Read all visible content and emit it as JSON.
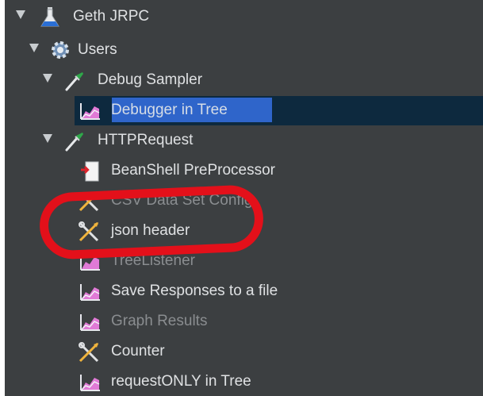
{
  "tree": {
    "items": [
      {
        "label": "Geth JRPC",
        "icon": "flask-icon",
        "expanded": true
      },
      {
        "label": "Users",
        "icon": "gear-icon",
        "expanded": true
      },
      {
        "label": "Debug Sampler",
        "icon": "pipette-icon",
        "expanded": true
      },
      {
        "label": "Debugger in Tree",
        "icon": "listener-chart-icon",
        "selected": true
      },
      {
        "label": "HTTPRequest",
        "icon": "pipette-icon",
        "expanded": true
      },
      {
        "label": "BeanShell PreProcessor",
        "icon": "preprocessor-icon"
      },
      {
        "label": "CSV Data Set Config",
        "icon": "config-scissors-icon",
        "dimmed": true
      },
      {
        "label": "json header",
        "icon": "config-scissors-icon",
        "annotated": true
      },
      {
        "label": "TreeListener",
        "icon": "listener-chart-icon",
        "dimmed": true
      },
      {
        "label": "Save Responses to a file",
        "icon": "listener-chart-icon"
      },
      {
        "label": "Graph Results",
        "icon": "listener-chart-icon",
        "dimmed": true
      },
      {
        "label": "Counter",
        "icon": "config-scissors-icon"
      },
      {
        "label": "requestONLY in Tree",
        "icon": "listener-chart-icon"
      }
    ]
  },
  "colors": {
    "tree_background": "#3c3f41",
    "selection": "#2f65ca",
    "annotation_ring": "#e3101a"
  }
}
